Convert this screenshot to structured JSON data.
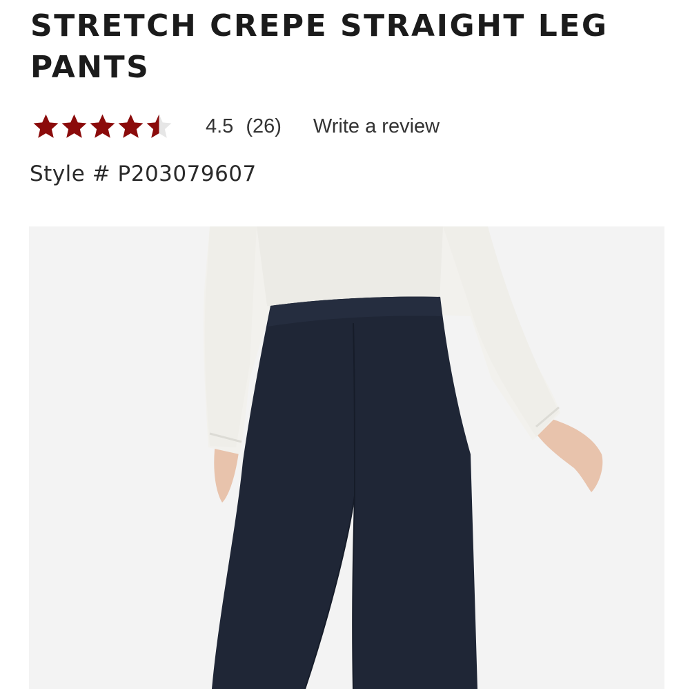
{
  "product": {
    "title": "STRETCH CREPE STRAIGHT LEG PANTS",
    "rating": {
      "value": "4.5",
      "stars": 4.5,
      "count": "(26)",
      "write_review": "Write a review",
      "star_color": "#8b0b0b"
    },
    "style_number": "Style # P203079607",
    "image": {
      "alt": "Model wearing navy stretch crepe straight leg pants with white blouse",
      "pants_color": "#1f2636",
      "blouse_color": "#f2f1ed",
      "background_color": "#f3f3f3"
    }
  }
}
